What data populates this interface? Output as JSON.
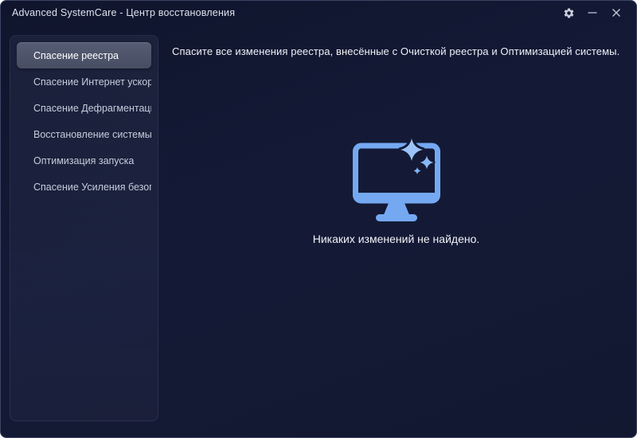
{
  "window": {
    "title": "Advanced SystemCare - Центр восстановления",
    "controls": {
      "settings": "settings",
      "minimize": "minimize",
      "close": "close"
    }
  },
  "sidebar": {
    "items": [
      {
        "label": "Спасение реестра",
        "active": true
      },
      {
        "label": "Спасение Интернет ускор…",
        "active": false
      },
      {
        "label": "Спасение Дефрагментаци…",
        "active": false
      },
      {
        "label": "Восстановление системы",
        "active": false
      },
      {
        "label": "Оптимизация запуска",
        "active": false
      },
      {
        "label": "Спасение Усиления безоп…",
        "active": false
      }
    ]
  },
  "main": {
    "header": "Спасите все изменения реестра, внесённые с Очисткой реестра и Оптимизацией системы.",
    "empty_state": {
      "icon": "monitor-with-sparkles-icon",
      "message": "Никаких изменений не найдено."
    }
  },
  "icons": {
    "titlebar": [
      "settings-gear-icon",
      "minimize-icon",
      "close-icon"
    ]
  },
  "colors": {
    "window_bg": "#131833",
    "sidebar_selected_bg": "#4b5166",
    "accent_blue": "#74a9f2",
    "sparkle_blue": "#9cc3f8",
    "text_primary": "#eef1f8",
    "text_secondary": "#c6ccdc"
  }
}
